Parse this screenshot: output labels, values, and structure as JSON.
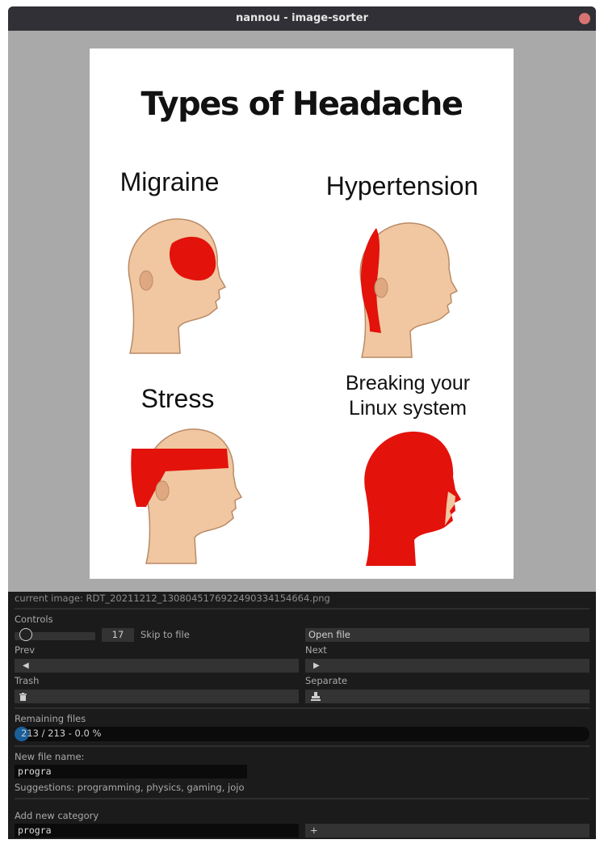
{
  "window": {
    "title": "nannou - image-sorter"
  },
  "meme": {
    "title": "Types of Headache",
    "panels": [
      {
        "label": "Migraine",
        "area": "circle"
      },
      {
        "label": "Hypertension",
        "area": "back"
      },
      {
        "label": "Stress",
        "area": "band"
      },
      {
        "label_line1": "Breaking your",
        "label_line2": "Linux system",
        "area": "full"
      }
    ],
    "colors": {
      "skin": "#f0c7a0",
      "skin_shadow": "#b98a66",
      "pain": "#e3120b"
    }
  },
  "panel": {
    "current_image": "current image: RDT_20211212_1308045176922490334154664.png",
    "controls_label": "Controls",
    "skip_value": "17",
    "skip_label": "Skip to file",
    "slider_fraction": 0.0,
    "open_file": "Open file",
    "prev_label": "Prev",
    "next_label": "Next",
    "trash_label": "Trash",
    "separate_label": "Separate",
    "remaining_label": "Remaining files",
    "progress_text": "213 / 213 - 0.0 %",
    "progress_fraction": 0.0,
    "new_file_label": "New file name:",
    "new_file_value": "progra",
    "suggestions": "Suggestions: programming, physics, gaming, jojo",
    "add_category_label": "Add new category",
    "add_category_value": "progra",
    "add_button": "+",
    "icons": [
      "caret-left-icon",
      "caret-right-icon",
      "trash-icon",
      "stamp-icon"
    ],
    "accent": "#1a5f9a"
  }
}
